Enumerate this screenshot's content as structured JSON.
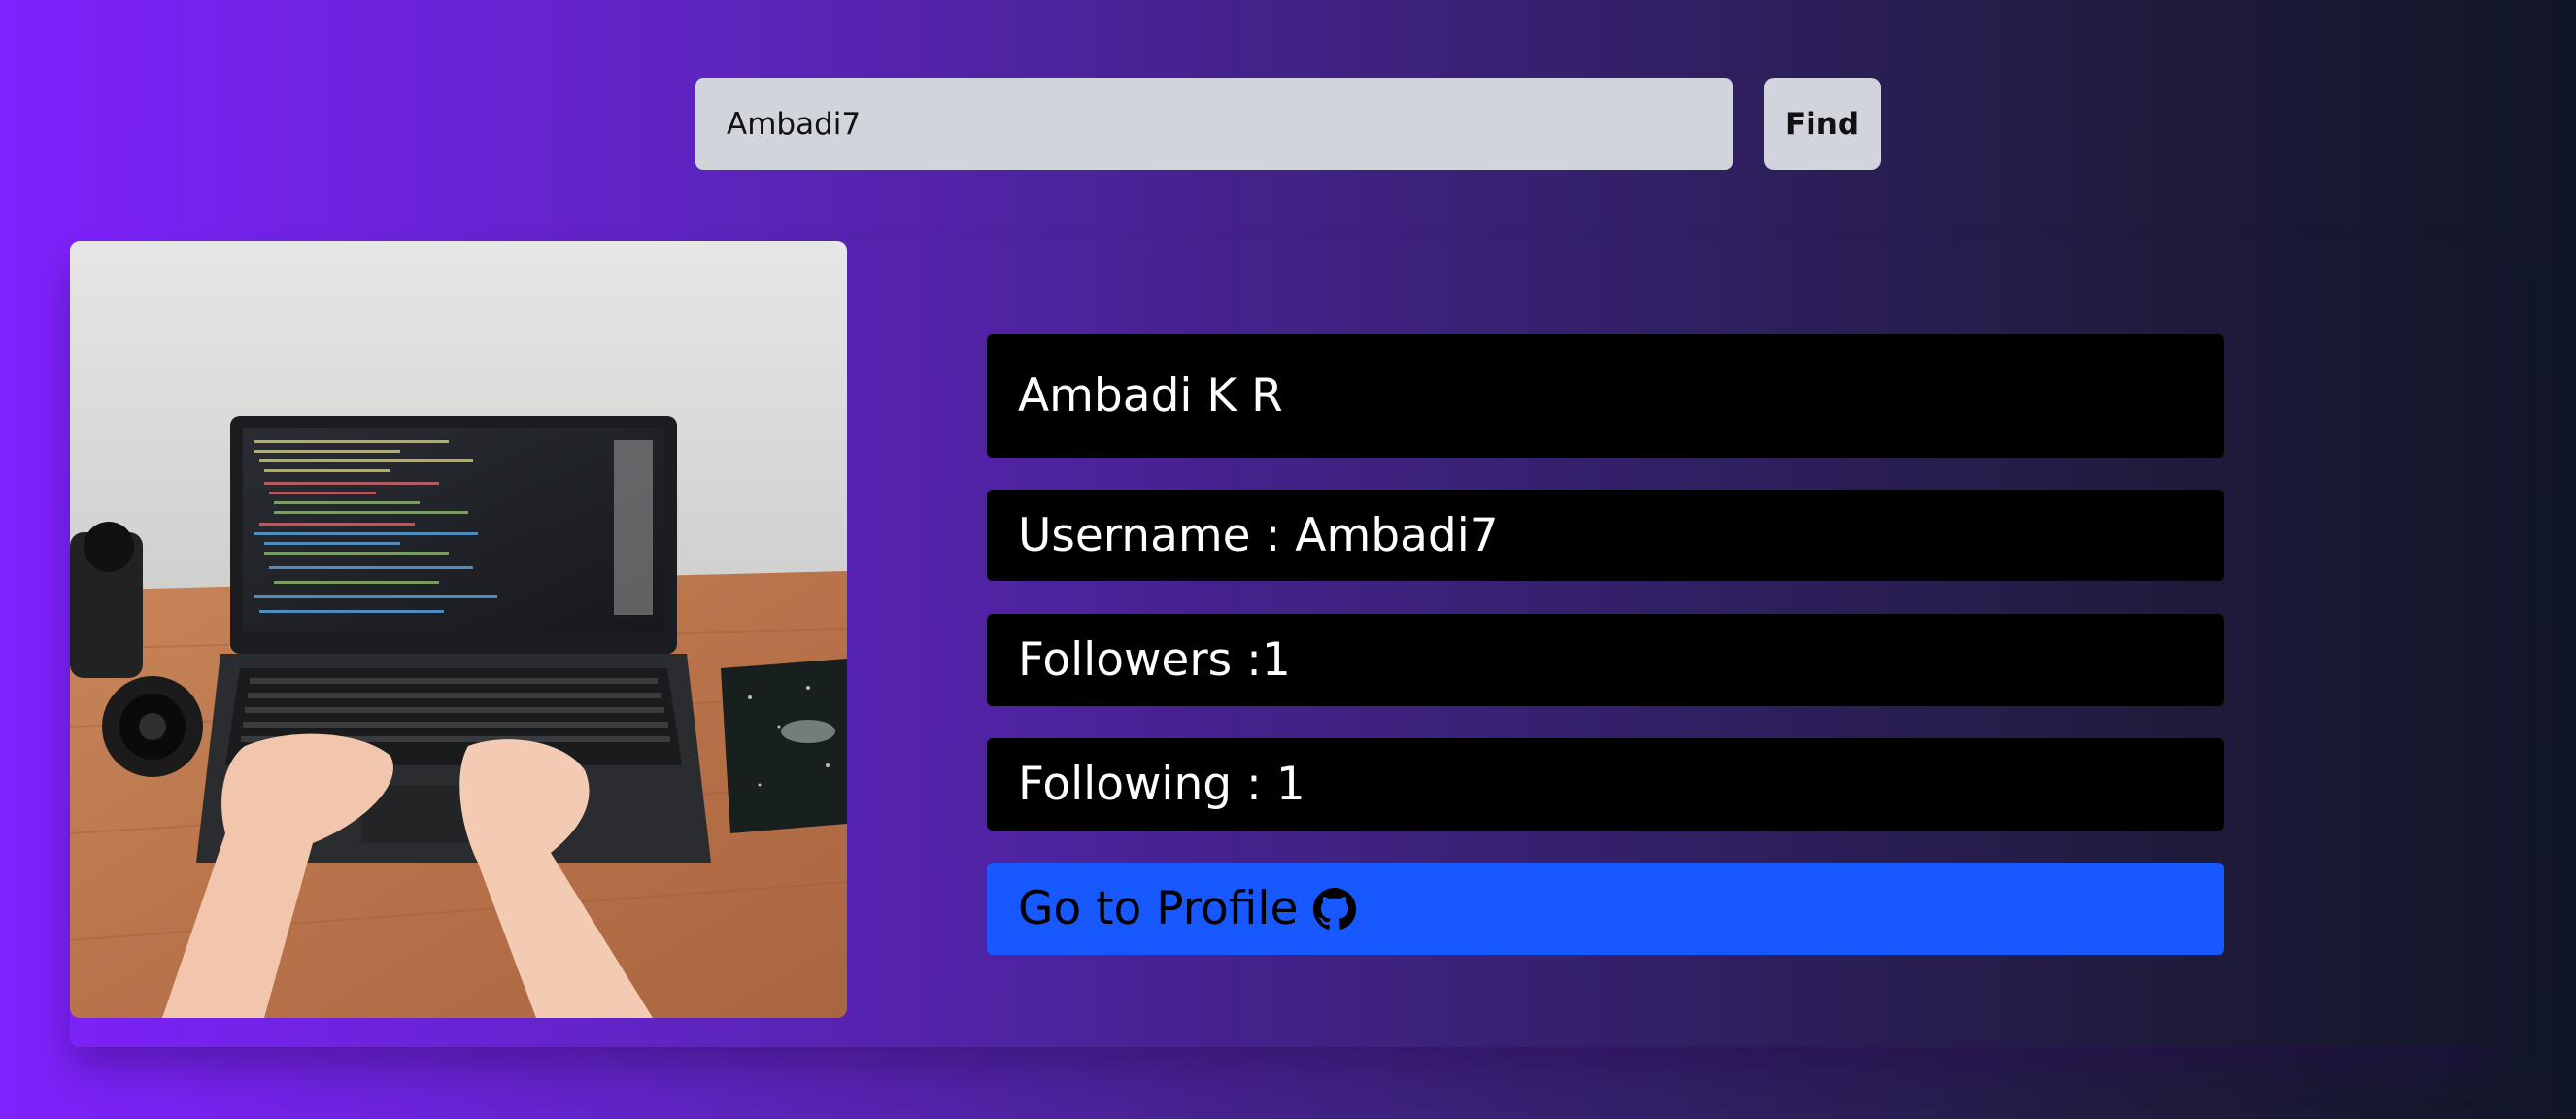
{
  "search": {
    "value": "Ambadi7",
    "find_label": "Find"
  },
  "profile": {
    "name": "Ambadi K R",
    "username_text": "Username : Ambadi7",
    "followers_text": "Followers :1",
    "following_text": "Following : 1",
    "go_to_profile_label": "Go to Profile",
    "profile_icon": "github-icon",
    "avatar_image": "laptop-desk-photo"
  },
  "colors": {
    "profile_button": "#1858ff",
    "info_box": "#000000",
    "search_field": "#d1d5db"
  }
}
